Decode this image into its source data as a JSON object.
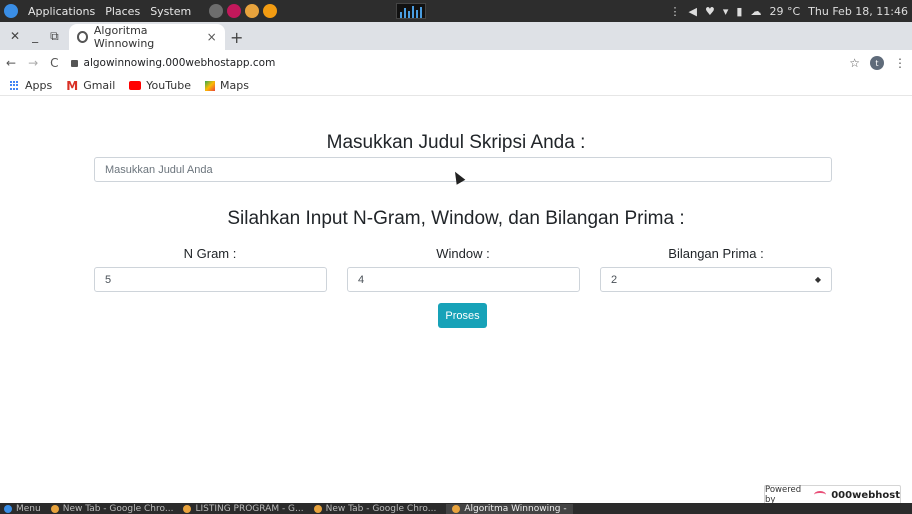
{
  "os_panel": {
    "menus": [
      "Applications",
      "Places",
      "System"
    ],
    "right": {
      "weather": "29 °C",
      "datetime": "Thu Feb 18, 11:46"
    }
  },
  "browser": {
    "tab_title": "Algoritma Winnowing",
    "tab_close": "×",
    "new_tab": "+",
    "window_close": "✕",
    "window_min": "_",
    "window_restore": "⧉",
    "url": "algowinnowing.000webhostapp.com",
    "avatar_letter": "t",
    "bookmarks": [
      "Apps",
      "Gmail",
      "YouTube",
      "Maps"
    ]
  },
  "page": {
    "title": "Masukkan Judul Skripsi Anda :",
    "title_placeholder": "Masukkan Judul Anda",
    "subtitle": "Silahkan Input N-Gram, Window, dan Bilangan Prima :",
    "ngram_label": "N Gram :",
    "ngram_value": "5",
    "window_label": "Window :",
    "window_value": "4",
    "prima_label": "Bilangan Prima :",
    "prima_value": "2",
    "submit_label": "Proses",
    "powered_by": "Powered by",
    "powered_brand": "000webhost"
  },
  "taskbar": {
    "menu": "Menu",
    "tasks": [
      "New Tab - Google Chro...",
      "LISTING PROGRAM - G...",
      "New Tab - Google Chro...",
      "Algoritma Winnowing -"
    ]
  }
}
